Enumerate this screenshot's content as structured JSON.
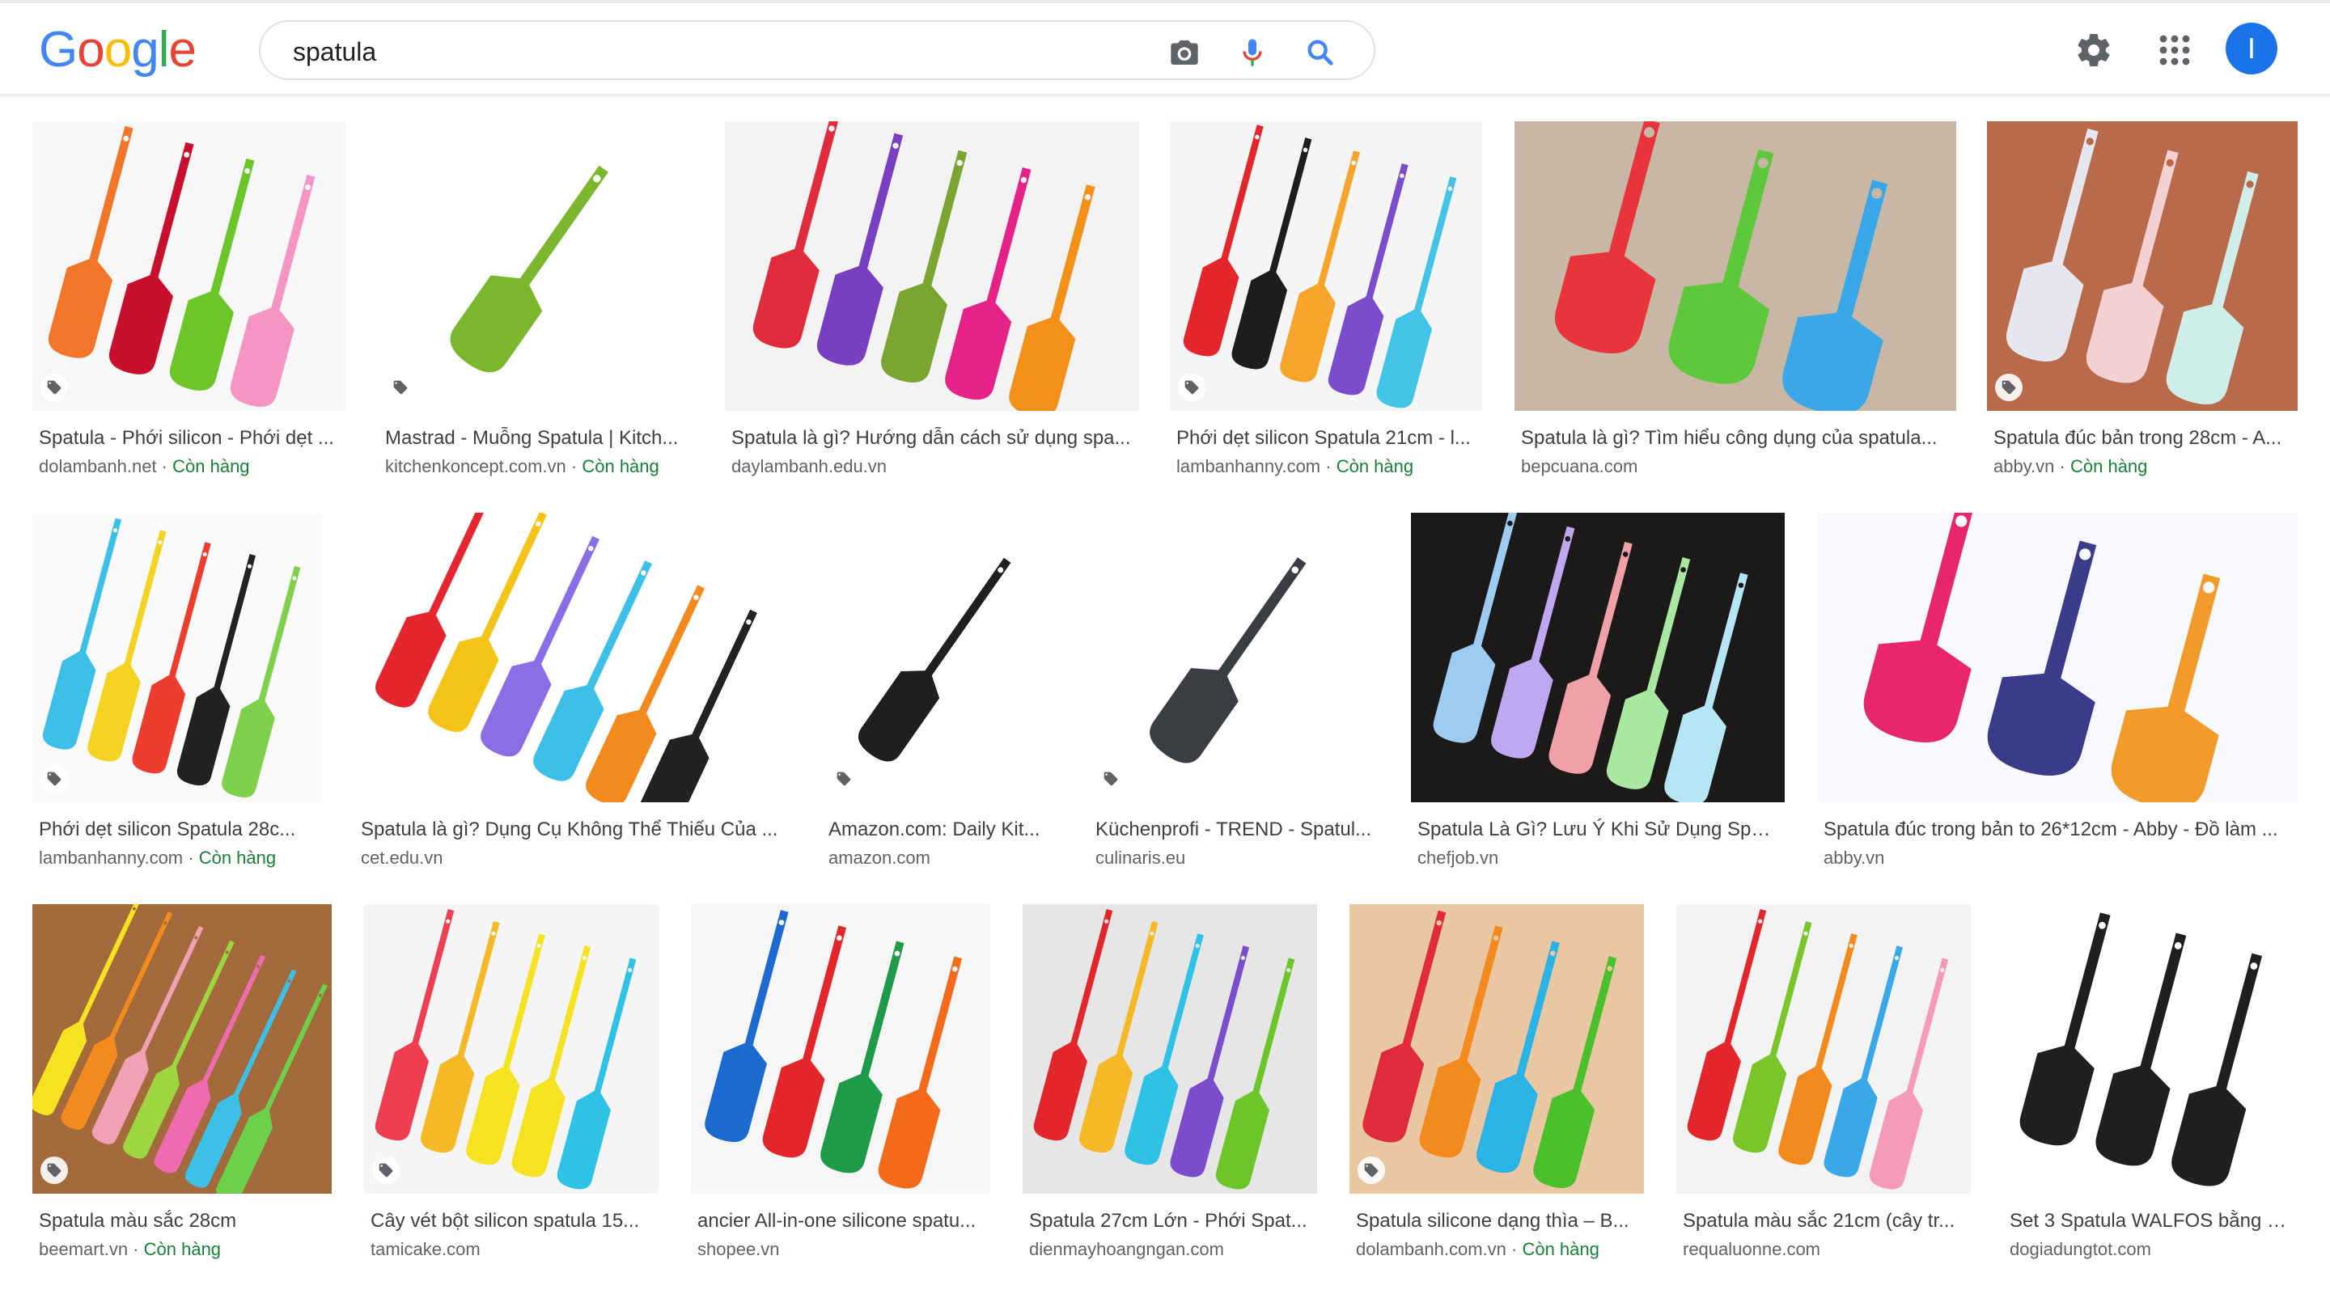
{
  "search": {
    "query": "spatula"
  },
  "header": {
    "logo": [
      "G",
      "o",
      "o",
      "g",
      "l",
      "e"
    ],
    "avatar_letter": "I",
    "icons": [
      "camera-icon",
      "mic-icon",
      "search-icon",
      "gear-icon",
      "apps-icon"
    ]
  },
  "colors": {
    "accent": "#1a73e8",
    "in_stock": "#188038",
    "source": "#5f6368",
    "title": "#3c4043"
  },
  "results": [
    {
      "title": "Spatula - Phới silicon - Phới dẹt ...",
      "source": "dolambanh.net",
      "stock": "Còn hàng",
      "tag": true,
      "bg": "#f7f7f7",
      "colors": [
        "#f2762a",
        "#c8102e",
        "#6cc62a",
        "#f595c4"
      ]
    },
    {
      "title": "Mastrad - Muỗng Spatula | Kitch...",
      "source": "kitchenkoncept.com.vn",
      "stock": "Còn hàng",
      "tag": true,
      "bg": "#ffffff",
      "colors": [
        "#7ab72d"
      ]
    },
    {
      "title": "Spatula là gì? Hướng dẫn cách sử dụng spa...",
      "source": "daylambanh.edu.vn",
      "stock": "",
      "tag": false,
      "bg": "#f3f3f3",
      "colors": [
        "#e02b3c",
        "#7a3fc0",
        "#7aa531",
        "#e6228a",
        "#f29018"
      ]
    },
    {
      "title": "Phới dẹt silicon Spatula 21cm - l...",
      "source": "lambanhanny.com",
      "stock": "Còn hàng",
      "tag": true,
      "bg": "#f5f5f5",
      "colors": [
        "#e3262c",
        "#1d1d1d",
        "#f6a52a",
        "#7b4dcc",
        "#43c3e6"
      ]
    },
    {
      "title": "Spatula là gì? Tìm hiểu công dụng của spatula...",
      "source": "bepcuana.com",
      "stock": "",
      "tag": false,
      "bg": "#c8b7a4",
      "colors": [
        "#e8343a",
        "#5cc83a",
        "#3aa8e8"
      ]
    },
    {
      "title": "Spatula đúc bản trong 28cm - A...",
      "source": "abby.vn",
      "stock": "Còn hàng",
      "tag": true,
      "bg": "#b96a4a",
      "colors": [
        "#e6e6ef",
        "#f3d0d2",
        "#cfeeea"
      ]
    },
    {
      "title": "Phới dẹt silicon Spatula 28c...",
      "source": "lambanhanny.com",
      "stock": "Còn hàng",
      "tag": true,
      "bg": "#fafafa",
      "colors": [
        "#3cc0e8",
        "#f5d323",
        "#ef3d2d",
        "#222222",
        "#7fd04a"
      ]
    },
    {
      "title": "Spatula là gì? Dụng Cụ Không Thể Thiếu Của ...",
      "source": "cet.edu.vn",
      "stock": "",
      "tag": false,
      "bg": "#ffffff",
      "colors": [
        "#e6262e",
        "#f4c418",
        "#8b6ee6",
        "#3cc0e8",
        "#f28a1e",
        "#222222"
      ]
    },
    {
      "title": "Amazon.com: Daily Kit...",
      "source": "amazon.com",
      "stock": "",
      "tag": true,
      "bg": "#ffffff",
      "colors": [
        "#1f1f1f"
      ]
    },
    {
      "title": "Küchenprofi - TREND - Spatul...",
      "source": "culinaris.eu",
      "stock": "",
      "tag": true,
      "bg": "#ffffff",
      "colors": [
        "#3a3d42"
      ]
    },
    {
      "title": "Spatula Là Gì? Lưu Ý Khi Sử Dụng Spat...",
      "source": "chefjob.vn",
      "stock": "",
      "tag": false,
      "bg": "#1b1a19",
      "colors": [
        "#9ecbf2",
        "#bfa7f2",
        "#f0a0a6",
        "#a8e8a0",
        "#b6e6f5"
      ]
    },
    {
      "title": "Spatula đúc trong bản to 26*12cm - Abby - Đồ làm ...",
      "source": "abby.vn",
      "stock": "",
      "tag": false,
      "bg": "#f7f9fc",
      "colors": [
        "#e8266e",
        "#3b3b8c",
        "#f29a2a"
      ]
    },
    {
      "title": "Spatula màu sắc 28cm",
      "source": "beemart.vn",
      "stock": "Còn hàng",
      "tag": true,
      "bg": "#a36a3c",
      "colors": [
        "#f5e321",
        "#f28a1e",
        "#f2a0b6",
        "#9ed640",
        "#f06ab0",
        "#3cc0e8",
        "#6cd04a"
      ]
    },
    {
      "title": "Cây vét bột silicon spatula 15...",
      "source": "tamicake.com",
      "stock": "",
      "tag": true,
      "bg": "#f5f5f5",
      "colors": [
        "#ef3d52",
        "#f5b928",
        "#f5e321",
        "#f5e321",
        "#2ec3e6"
      ]
    },
    {
      "title": "ancier All-in-one silicone spatu...",
      "source": "shopee.vn",
      "stock": "",
      "tag": false,
      "bg": "#f6f6f6",
      "colors": [
        "#1c6ad0",
        "#e3262c",
        "#1f9a48",
        "#f26a1a"
      ]
    },
    {
      "title": "Spatula 27cm Lớn - Phới Spat...",
      "source": "dienmayhoangngan.com",
      "stock": "",
      "tag": false,
      "bg": "#e6e6e6",
      "colors": [
        "#e3262c",
        "#f5b928",
        "#2ec3e6",
        "#7b4dcc",
        "#6cc62a"
      ]
    },
    {
      "title": "Spatula silicone dạng thìa – B...",
      "source": "dolambanh.com.vn",
      "stock": "Còn hàng",
      "tag": true,
      "bg": "#e9c7a3",
      "colors": [
        "#e02b3c",
        "#f28a1e",
        "#2ab4e6",
        "#4ac02a"
      ]
    },
    {
      "title": "Spatula màu sắc 21cm (cây tr...",
      "source": "requaluonne.com",
      "stock": "",
      "tag": false,
      "bg": "#f3f3f3",
      "colors": [
        "#e3262c",
        "#7ac62a",
        "#f28a1e",
        "#3aa8e8",
        "#f59ab8"
      ]
    },
    {
      "title": "Set 3 Spatula WALFOS bằng S...",
      "source": "dogiadungtot.com",
      "stock": "",
      "tag": false,
      "bg": "#ffffff",
      "colors": [
        "#1f1f1f",
        "#1f1f1f",
        "#1f1f1f"
      ]
    }
  ]
}
